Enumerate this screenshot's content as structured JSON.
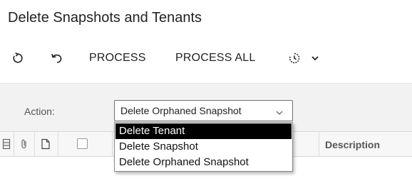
{
  "page": {
    "title": "Delete Snapshots and Tenants"
  },
  "toolbar": {
    "refresh_icon": "refresh-icon",
    "undo_icon": "undo-icon",
    "process_label": "PROCESS",
    "process_all_label": "PROCESS ALL",
    "schedule_icon": "schedule-icon",
    "more_icon": "chevron-down-icon"
  },
  "filter": {
    "action_label": "Action:",
    "action_value": "Delete Orphaned Snapshot",
    "options": [
      {
        "label": "Delete Tenant",
        "selected": true
      },
      {
        "label": "Delete Snapshot",
        "selected": false
      },
      {
        "label": "Delete Orphaned Snapshot",
        "selected": false
      }
    ]
  },
  "grid": {
    "header_icons": [
      "schema-icon",
      "attachment-icon",
      "document-icon"
    ],
    "select_all_checked": false,
    "columns": {
      "description": "Description"
    }
  },
  "colors": {
    "highlight_bg": "#000000",
    "highlight_text": "#ffffff",
    "filter_bg": "#f2f2f2"
  }
}
